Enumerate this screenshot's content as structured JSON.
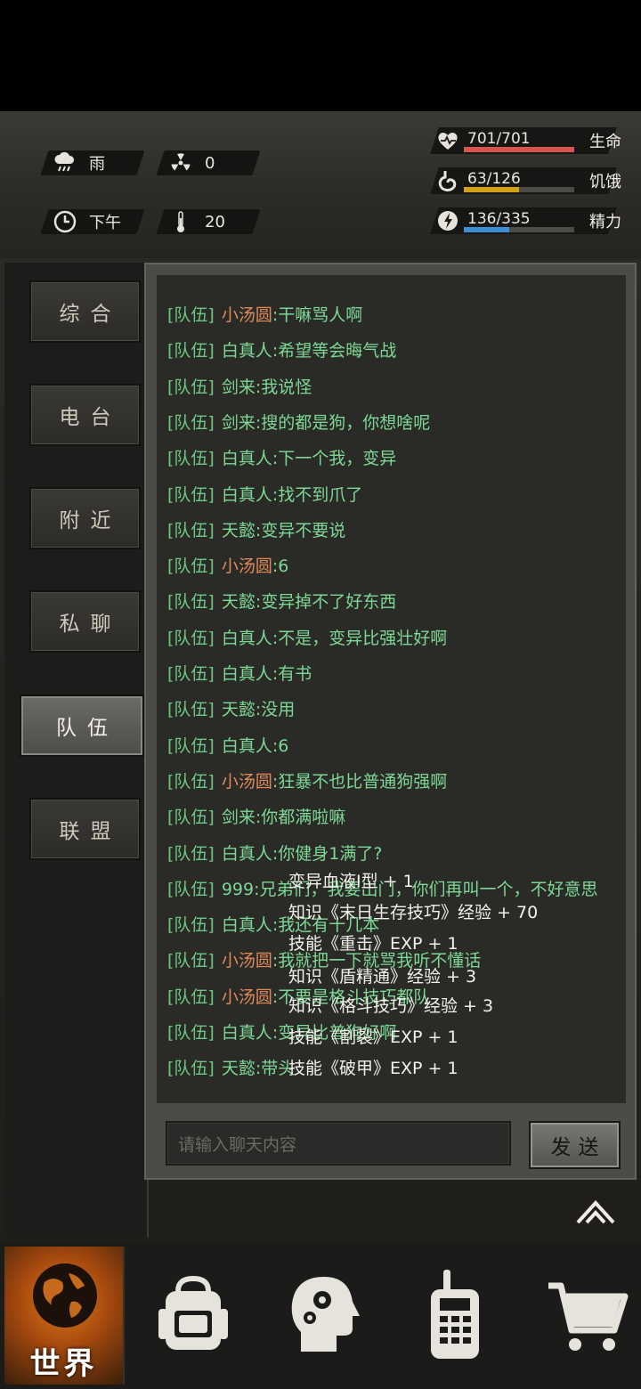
{
  "status": {
    "weather": {
      "icon": "rain-cloud-icon",
      "label": "雨"
    },
    "radiation": {
      "icon": "radiation-icon",
      "value": "0"
    },
    "time": {
      "icon": "clock-icon",
      "label": "下午"
    },
    "temperature": {
      "icon": "thermometer-icon",
      "value": "20"
    }
  },
  "stats": {
    "health": {
      "value": "701/701",
      "label": "生命",
      "fraction": 1.0,
      "color": "#d9534f",
      "icon": "heart-icon"
    },
    "hunger": {
      "value": "63/126",
      "label": "饥饿",
      "fraction": 0.5,
      "color": "#d4a017",
      "icon": "stomach-icon"
    },
    "energy": {
      "value": "136/335",
      "label": "精力",
      "fraction": 0.41,
      "color": "#3b8fd4",
      "icon": "lightning-icon"
    }
  },
  "tabs": [
    "综合",
    "电台",
    "附近",
    "私聊",
    "队伍",
    "联盟"
  ],
  "active_tab": "队伍",
  "messages": [
    {
      "tag": "[队伍]",
      "name": "小汤圆",
      "text": ":干嘛骂人啊",
      "orange": true
    },
    {
      "tag": "[队伍]",
      "name": "白真人",
      "text": ":希望等会晦气战",
      "orange": false
    },
    {
      "tag": "[队伍]",
      "name": "剑来",
      "text": ":我说怪",
      "orange": false
    },
    {
      "tag": "[队伍]",
      "name": "剑来",
      "text": ":搜的都是狗，你想啥呢",
      "orange": false
    },
    {
      "tag": "[队伍]",
      "name": "白真人",
      "text": ":下一个我，变异",
      "orange": false
    },
    {
      "tag": "[队伍]",
      "name": "白真人",
      "text": ":找不到爪了",
      "orange": false
    },
    {
      "tag": "[队伍]",
      "name": "天懿",
      "text": ":变异不要说",
      "orange": false
    },
    {
      "tag": "[队伍]",
      "name": "小汤圆",
      "text": ":6",
      "orange": true
    },
    {
      "tag": "[队伍]",
      "name": "天懿",
      "text": ":变异掉不了好东西",
      "orange": false
    },
    {
      "tag": "[队伍]",
      "name": "白真人",
      "text": ":不是，变异比强壮好啊",
      "orange": false
    },
    {
      "tag": "[队伍]",
      "name": "白真人",
      "text": ":有书",
      "orange": false
    },
    {
      "tag": "[队伍]",
      "name": "天懿",
      "text": ":没用",
      "orange": false
    },
    {
      "tag": "[队伍]",
      "name": "白真人",
      "text": ":6",
      "orange": false
    },
    {
      "tag": "[队伍]",
      "name": "小汤圆",
      "text": ":狂暴不也比普通狗强啊",
      "orange": true
    },
    {
      "tag": "[队伍]",
      "name": "剑来",
      "text": ":你都满啦嘛",
      "orange": false
    },
    {
      "tag": "[队伍]",
      "name": "白真人",
      "text": ":你健身1满了?",
      "orange": false
    },
    {
      "tag": "[队伍]",
      "name": "999",
      "text": ":兄弟们，我要出门，你们再叫一个，不好意思",
      "orange": false
    },
    {
      "tag": "[队伍]",
      "name": "白真人",
      "text": ":我还有十几本",
      "orange": false
    },
    {
      "tag": "[队伍]",
      "name": "小汤圆",
      "text": ":我就把一下就骂我听不懂话",
      "orange": true
    },
    {
      "tag": "[队伍]",
      "name": "小汤圆",
      "text": ":不要是格斗技巧都队",
      "orange": true
    },
    {
      "tag": "[队伍]",
      "name": "白真人",
      "text": ":变异比普狗好啊",
      "orange": false
    },
    {
      "tag": "[队伍]",
      "name": "天懿",
      "text": ":带头",
      "orange": false
    }
  ],
  "reward_log": [
    "变异血液Ⅰ型 + 1",
    "知识《末日生存技巧》经验 + 70",
    "技能《重击》EXP + 1",
    "知识《盾精通》经验 + 3",
    "知识《格斗技巧》经验 + 3",
    "技能《割裂》EXP + 1",
    "技能《破甲》EXP + 1"
  ],
  "chat_input": {
    "placeholder": "请输入聊天内容"
  },
  "send_label": "发送",
  "nav": {
    "world_label": "世界",
    "items": [
      "backpack-icon",
      "skills-head-icon",
      "radio-icon",
      "shop-cart-icon"
    ]
  }
}
